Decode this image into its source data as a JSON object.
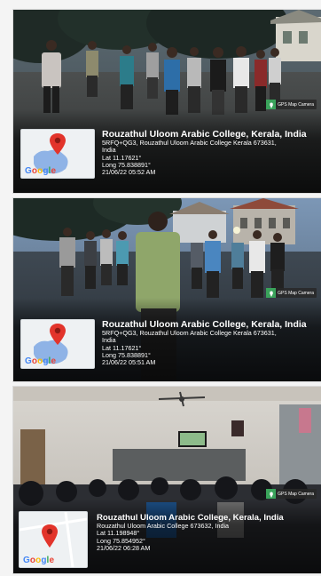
{
  "app_badge": "GPS Map Camera",
  "google_logo": [
    "G",
    "o",
    "o",
    "g",
    "l",
    "e"
  ],
  "google_colors": [
    "#4285F4",
    "#EA4335",
    "#FBBC05",
    "#4285F4",
    "#34A853",
    "#EA4335"
  ],
  "marker_color": "#e2342b",
  "photos": [
    {
      "title": "Rouzathul Uloom Arabic College, Kerala, India",
      "address_line1": "5RFQ+QG3, Rouzathul Uloom Arabic College Kerala 673631,",
      "address_line2": "India",
      "lat": "Lat 11.17621°",
      "long": "Long 75.838891°",
      "datetime": "21/06/22 05:52 AM"
    },
    {
      "title": "Rouzathul Uloom Arabic College, Kerala, India",
      "address_line1": "5RFQ+QG3, Rouzathul Uloom Arabic College Kerala 673631,",
      "address_line2": "India",
      "lat": "Lat 11.17621°",
      "long": "Long 75.838891°",
      "datetime": "21/06/22 05:51 AM"
    },
    {
      "title": "Rouzathul Uloom Arabic College, Kerala, India",
      "address_line1": "Rouzathul Uloom Arabic College 673632, India",
      "lat": "Lat 11.198948°",
      "long": "Long 75.854952°",
      "datetime": "21/06/22 06:28 AM"
    }
  ]
}
